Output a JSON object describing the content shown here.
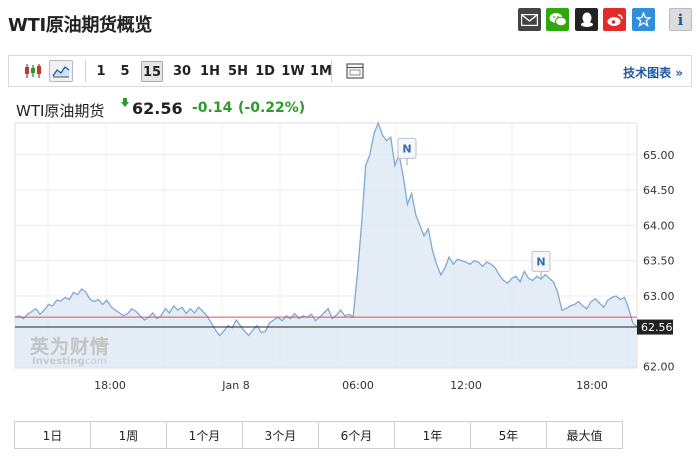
{
  "title": "WTI原油期货概览",
  "share": [
    {
      "name": "email-share-icon",
      "bg": "#444444",
      "glyph": "✉"
    },
    {
      "name": "wechat-share-icon",
      "bg": "#2ea80d",
      "glyph": "💬"
    },
    {
      "name": "qq-share-icon",
      "bg": "#222222",
      "glyph": "◒"
    },
    {
      "name": "weibo-share-icon",
      "bg": "#e32b27",
      "glyph": "◉"
    },
    {
      "name": "favorite-share-icon",
      "bg": "#2f8fd8",
      "glyph": "☆"
    },
    {
      "name": "info-icon",
      "bg": "#d9d9d9",
      "glyph": "i"
    }
  ],
  "toolbar": {
    "timeframes": [
      "1",
      "5",
      "15",
      "30",
      "1H",
      "5H",
      "1D",
      "1W",
      "1M"
    ],
    "active_timeframe": "15",
    "tech_link": "技术图表 »"
  },
  "quote": {
    "name": "WTI原油期货",
    "price": "62.56",
    "change": "-0.14",
    "change_pct": "(-0.22%)",
    "change_color": "#2c9a2c"
  },
  "chart_data": {
    "type": "area",
    "y_ticks": [
      "65.00",
      "64.50",
      "64.00",
      "63.50",
      "63.00",
      "62.00"
    ],
    "y_range": [
      61.98,
      65.45
    ],
    "last_price_label": "62.56",
    "x_ticks": [
      "18:00",
      "Jan 8",
      "06:00",
      "12:00",
      "18:00"
    ],
    "prior_close": 62.7,
    "markers": [
      {
        "label": "N",
        "value": 64.85
      },
      {
        "label": "N",
        "value": 63.25
      }
    ],
    "series": [
      {
        "values": [
          62.7,
          62.72,
          62.68,
          62.74,
          62.78,
          62.82,
          62.74,
          62.8,
          62.88,
          62.86,
          62.94,
          62.93,
          62.98,
          62.95,
          63.05,
          63.02,
          63.1,
          63.05,
          62.95,
          62.92,
          62.95,
          62.88,
          62.94,
          62.85,
          62.8,
          62.76,
          62.72,
          62.75,
          62.82,
          62.78,
          62.72,
          62.66,
          62.7,
          62.76,
          62.68,
          62.72,
          62.82,
          62.76,
          62.86,
          62.8,
          62.84,
          62.75,
          62.82,
          62.76,
          62.84,
          62.78,
          62.72,
          62.62,
          62.52,
          62.44,
          62.5,
          62.58,
          62.55,
          62.66,
          62.58,
          62.5,
          62.44,
          62.52,
          62.58,
          62.48,
          62.5,
          62.62,
          62.66,
          62.7,
          62.65,
          62.72,
          62.68,
          62.75,
          62.68,
          62.72,
          62.7,
          62.74,
          62.65,
          62.7,
          62.76,
          62.82,
          62.68,
          62.73,
          62.8,
          62.72,
          62.74,
          62.7,
          63.3,
          64.0,
          64.85,
          65.0,
          65.3,
          65.45,
          65.28,
          65.2,
          65.25,
          64.85,
          65.0,
          64.7,
          64.3,
          64.45,
          64.15,
          64.0,
          63.85,
          63.95,
          63.65,
          63.45,
          63.3,
          63.4,
          63.55,
          63.45,
          63.52,
          63.5,
          63.48,
          63.45,
          63.5,
          63.48,
          63.42,
          63.48,
          63.45,
          63.4,
          63.3,
          63.22,
          63.18,
          63.25,
          63.28,
          63.2,
          63.35,
          63.25,
          63.22,
          63.28,
          63.24,
          63.3,
          63.25,
          63.2,
          63.05,
          62.8,
          62.82,
          62.86,
          62.88,
          62.92,
          62.86,
          62.82,
          62.92,
          62.96,
          62.9,
          62.84,
          62.94,
          62.98,
          63.0,
          62.95,
          62.98,
          62.82,
          62.62,
          62.56
        ]
      }
    ]
  },
  "ranges": [
    "1日",
    "1周",
    "1个月",
    "3个月",
    "6个月",
    "1年",
    "5年",
    "最大值"
  ]
}
